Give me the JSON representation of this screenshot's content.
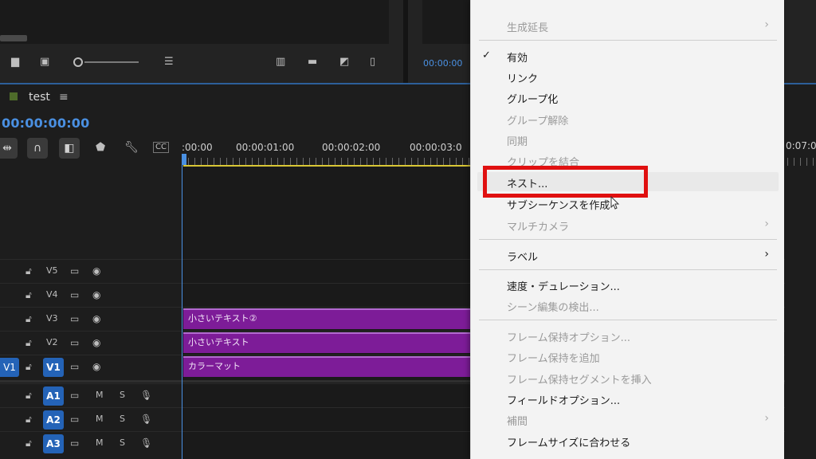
{
  "panels": {
    "program_timecode": "00:00:00"
  },
  "sequence": {
    "name": "test",
    "menu_icon": "≡",
    "timecode": "00:00:00:00"
  },
  "ruler": {
    "labels": [
      ":00:00",
      "00:00:01:00",
      "00:00:02:00",
      "00:00:03:0"
    ],
    "right_label": "0:07:0"
  },
  "tracks": {
    "video": [
      {
        "id": "V5",
        "clip": null
      },
      {
        "id": "V4",
        "clip": null
      },
      {
        "id": "V3",
        "clip": "小さいテキスト②"
      },
      {
        "id": "V2",
        "clip": "小さいテキスト"
      },
      {
        "id": "V1",
        "clip": "カラーマット",
        "source": "V1"
      }
    ],
    "audio": [
      {
        "id": "A1",
        "m": "M",
        "s": "S"
      },
      {
        "id": "A2",
        "m": "M",
        "s": "S"
      },
      {
        "id": "A3",
        "m": "M",
        "s": "S"
      }
    ]
  },
  "context_menu": {
    "items": [
      {
        "label": "生成延長",
        "disabled": true,
        "submenu": true
      },
      {
        "label": "有効",
        "checked": true
      },
      {
        "label": "リンク"
      },
      {
        "label": "グループ化"
      },
      {
        "label": "グループ解除",
        "disabled": true
      },
      {
        "label": "同期",
        "disabled": true
      },
      {
        "label": "クリップを結合",
        "disabled": true
      },
      {
        "label": "ネスト...",
        "highlighted": true
      },
      {
        "label": "サブシーケンスを作成"
      },
      {
        "label": "マルチカメラ",
        "disabled": true,
        "submenu": true
      },
      {
        "label": "ラベル",
        "submenu": true
      },
      {
        "label": "速度・デュレーション..."
      },
      {
        "label": "シーン編集の検出...",
        "disabled": true
      },
      {
        "label": "フレーム保持オプション...",
        "disabled": true
      },
      {
        "label": "フレーム保持を追加",
        "disabled": true
      },
      {
        "label": "フレーム保持セグメントを挿入",
        "disabled": true
      },
      {
        "label": "フィールドオプション..."
      },
      {
        "label": "補間",
        "disabled": true,
        "submenu": true
      },
      {
        "label": "フレームサイズに合わせる"
      }
    ],
    "checkmark": "✓",
    "submenu_arrow": "›"
  },
  "colors": {
    "accent_blue": "#4a90e2",
    "clip_purple": "#7d1c98",
    "highlight_red": "#e01010"
  }
}
